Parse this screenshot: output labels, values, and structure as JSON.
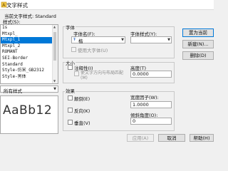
{
  "window": {
    "title": "文字样式"
  },
  "current_style": {
    "text": "当前文字样式: Standard"
  },
  "styles_label": "样式(S):",
  "styles": {
    "items": [
      "1s",
      "Mtxpl_",
      "Mtxpl_1",
      "Mtxpl_2",
      "ROMANT",
      "SEI-Border",
      "Standard",
      "Style-仿宋_GB2312",
      "Style-黑体"
    ],
    "selected_index": 2
  },
  "filter": {
    "value": "所有样式"
  },
  "preview": {
    "text": "AaBb12"
  },
  "font": {
    "group_title": "字体",
    "name_label": "字体名(F):",
    "name_value": "楷",
    "style_label": "字体样式(Y):",
    "bigfont_label": "使用大字体(U)"
  },
  "size": {
    "group_title": "大小",
    "annotative_label": "注释性(I)",
    "match_orientation_label": "使文字方向与布局匹配(M)",
    "height_label": "高度(T)",
    "height_value": "0.0000"
  },
  "effects": {
    "group_title": "效果",
    "upside_down_label": "颠倒(E)",
    "backwards_label": "反向(K)",
    "vertical_label": "垂直(V)",
    "width_factor_label": "宽度因子(W):",
    "width_factor_value": "1.0000",
    "oblique_label": "倾斜角度(O):",
    "oblique_value": "0"
  },
  "buttons": {
    "set_current": "置为当前",
    "new": "新建(N)...",
    "delete": "删除(D)",
    "apply": "应用(A)",
    "cancel": "取消",
    "help": "帮助(H)"
  },
  "colors": {
    "accent": "#0078d7",
    "icon": "#e0a020"
  }
}
